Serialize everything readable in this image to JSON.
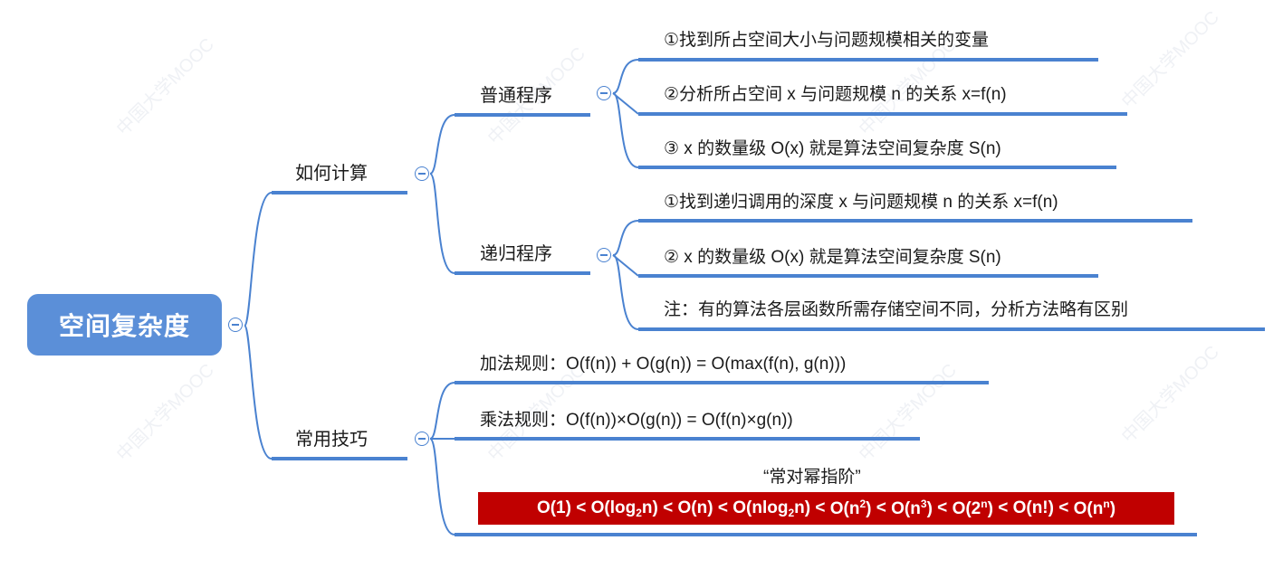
{
  "root": {
    "label": "空间复杂度"
  },
  "branches": {
    "how_to_calc": {
      "label": "如何计算",
      "normal": {
        "label": "普通程序",
        "items": [
          "①找到所占空间大小与问题规模相关的变量",
          "②分析所占空间 x 与问题规模 n 的关系 x=f(n)",
          "③ x 的数量级 O(x) 就是算法空间复杂度 S(n)"
        ]
      },
      "recursive": {
        "label": "递归程序",
        "items": [
          "①找到递归调用的深度 x 与问题规模 n 的关系 x=f(n)",
          "②  x 的数量级 O(x) 就是算法空间复杂度 S(n)",
          "注：有的算法各层函数所需存储空间不同，分析方法略有区别"
        ]
      }
    },
    "tips": {
      "label": "常用技巧",
      "add_rule": "加法规则：O(f(n)) + O(g(n)) = O(max(f(n), g(n)))",
      "mul_rule": "乘法规则：O(f(n))×O(g(n)) = O(f(n)×g(n))",
      "mnemonic": "“常对幂指阶”",
      "order_terms": [
        "O(1)",
        "O(log",
        "2",
        "n)",
        "O(n)",
        "O(nlog",
        "2",
        "n)",
        "O(n",
        "2",
        ")",
        "O(n",
        "3",
        ")",
        "O(2",
        "n",
        ")",
        "O(n!)",
        "O(n",
        "n",
        ")"
      ],
      "separator": "<"
    }
  },
  "watermark": "中国大学MOOC",
  "colors": {
    "accent": "#4a82d0",
    "root_fill": "#5b8fd8",
    "highlight": "#c00000"
  }
}
